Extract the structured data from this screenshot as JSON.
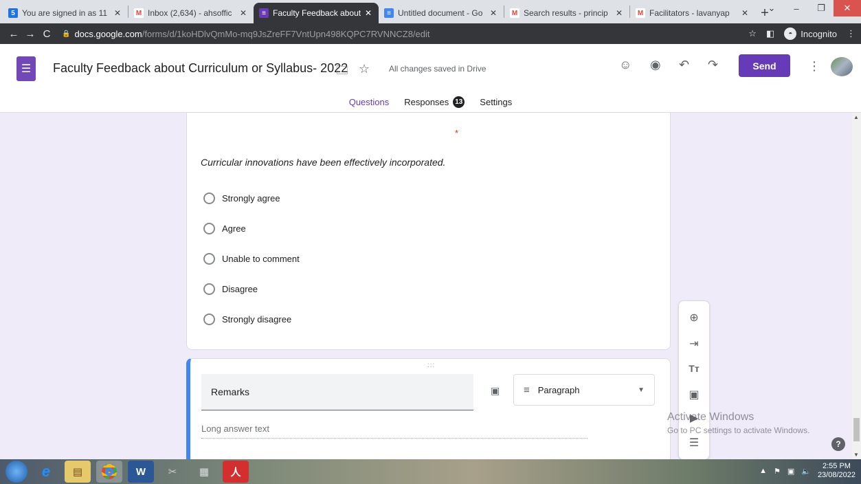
{
  "browser": {
    "tabs": [
      {
        "label": "You are signed in as 11",
        "fav": "5",
        "favColor": "#1a73e8",
        "active": false
      },
      {
        "label": "Inbox (2,634) - ahsoffic",
        "fav": "M",
        "favColor": "#ea4335",
        "active": false
      },
      {
        "label": "Faculty Feedback about",
        "fav": "≡",
        "favColor": "#673ab7",
        "active": true
      },
      {
        "label": "Untitled document - Go",
        "fav": "≡",
        "favColor": "#4285f4",
        "active": false
      },
      {
        "label": "Search results - princip",
        "fav": "M",
        "favColor": "#ea4335",
        "active": false
      },
      {
        "label": "Facilitators - lavanyap",
        "fav": "M",
        "favColor": "#ea4335",
        "active": false
      }
    ],
    "url_host": "docs.google.com",
    "url_path": "/forms/d/1koHDlvQmMo-mq9JsZreFF7VntUpn498KQPC7RVNNCZ8/edit",
    "incognito_label": "Incognito"
  },
  "form": {
    "title": "Faculty Feedback about Curriculum or Syllabus- 2022",
    "save_status": "All changes saved in Drive",
    "send_label": "Send",
    "tabs": {
      "questions": "Questions",
      "responses": "Responses",
      "responses_count": "13",
      "settings": "Settings"
    }
  },
  "question1": {
    "required_mark": "*",
    "text": "Curricular innovations have been effectively incorporated.",
    "options": [
      "Strongly agree",
      "Agree",
      "Unable to comment",
      "Disagree",
      "Strongly disagree"
    ]
  },
  "question2": {
    "drag_handle": ":::",
    "title": "Remarks",
    "type": "Paragraph",
    "answer_hint": "Long answer text"
  },
  "watermark": {
    "line1": "Activate Windows",
    "line2": "Go to PC settings to activate Windows."
  },
  "taskbar": {
    "time": "2:55 PM",
    "date": "23/08/2022"
  },
  "colors": {
    "accent": "#673ab7",
    "active_question": "#4285f4",
    "background": "#f0ebf8"
  }
}
